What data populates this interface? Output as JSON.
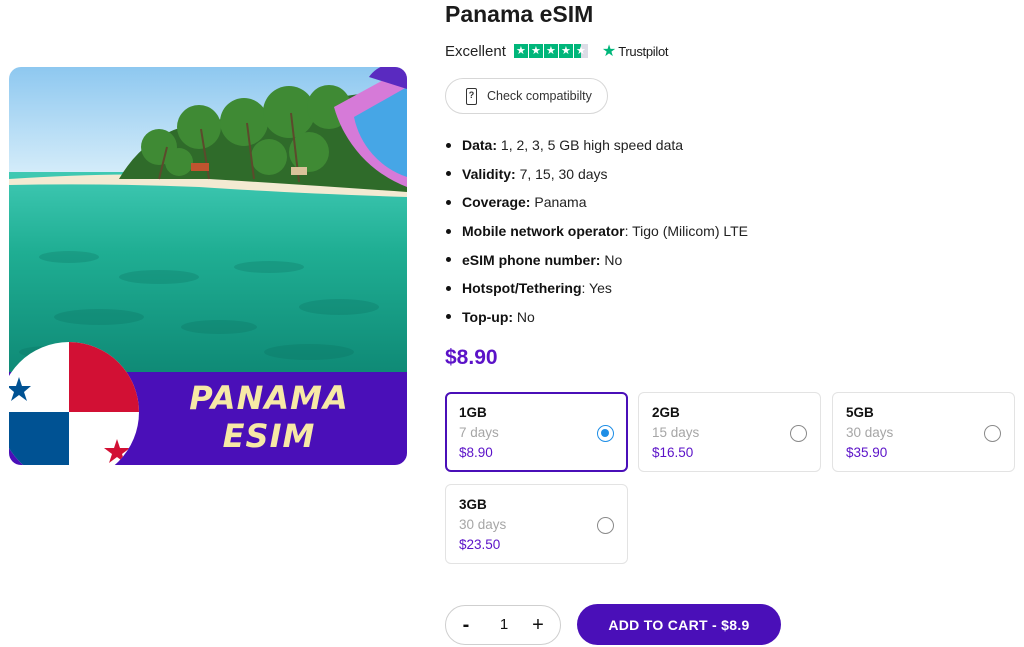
{
  "product": {
    "title": "Panama eSIM",
    "hero_title_line1": "PANAMA",
    "hero_title_line2": "ESIM",
    "rating_label": "Excellent",
    "rating_stars": 4.5,
    "rating_brand": "Trustpilot",
    "compat_button": "Check compatibilty",
    "price": "$8.90"
  },
  "specs": [
    {
      "label": "Data:",
      "value": " 1, 2, 3, 5 GB high speed data"
    },
    {
      "label": "Validity:",
      "value": " 7, 15, 30 days"
    },
    {
      "label": "Coverage:",
      "value": " Panama"
    },
    {
      "label": "Mobile network operator",
      "value": ": Tigo (Milicom) LTE"
    },
    {
      "label": "eSIM phone number:",
      "value": " No"
    },
    {
      "label": "Hotspot/Tethering",
      "value": ": Yes"
    },
    {
      "label": "Top-up:",
      "value": " No"
    }
  ],
  "plans": [
    {
      "gb": "1GB",
      "days": "7 days",
      "price": "$8.90",
      "selected": true
    },
    {
      "gb": "2GB",
      "days": "15 days",
      "price": "$16.50",
      "selected": false
    },
    {
      "gb": "5GB",
      "days": "30 days",
      "price": "$35.90",
      "selected": false
    },
    {
      "gb": "3GB",
      "days": "30 days",
      "price": "$23.50",
      "selected": false
    }
  ],
  "quantity": {
    "minus": "-",
    "value": "1",
    "plus": "+"
  },
  "cart_button": "ADD TO CART - $8.9",
  "colors": {
    "accent": "#4a0fb8",
    "price": "#5b12c8",
    "trustpilot": "#00b67a",
    "radio_selected": "#1e8ee6"
  }
}
